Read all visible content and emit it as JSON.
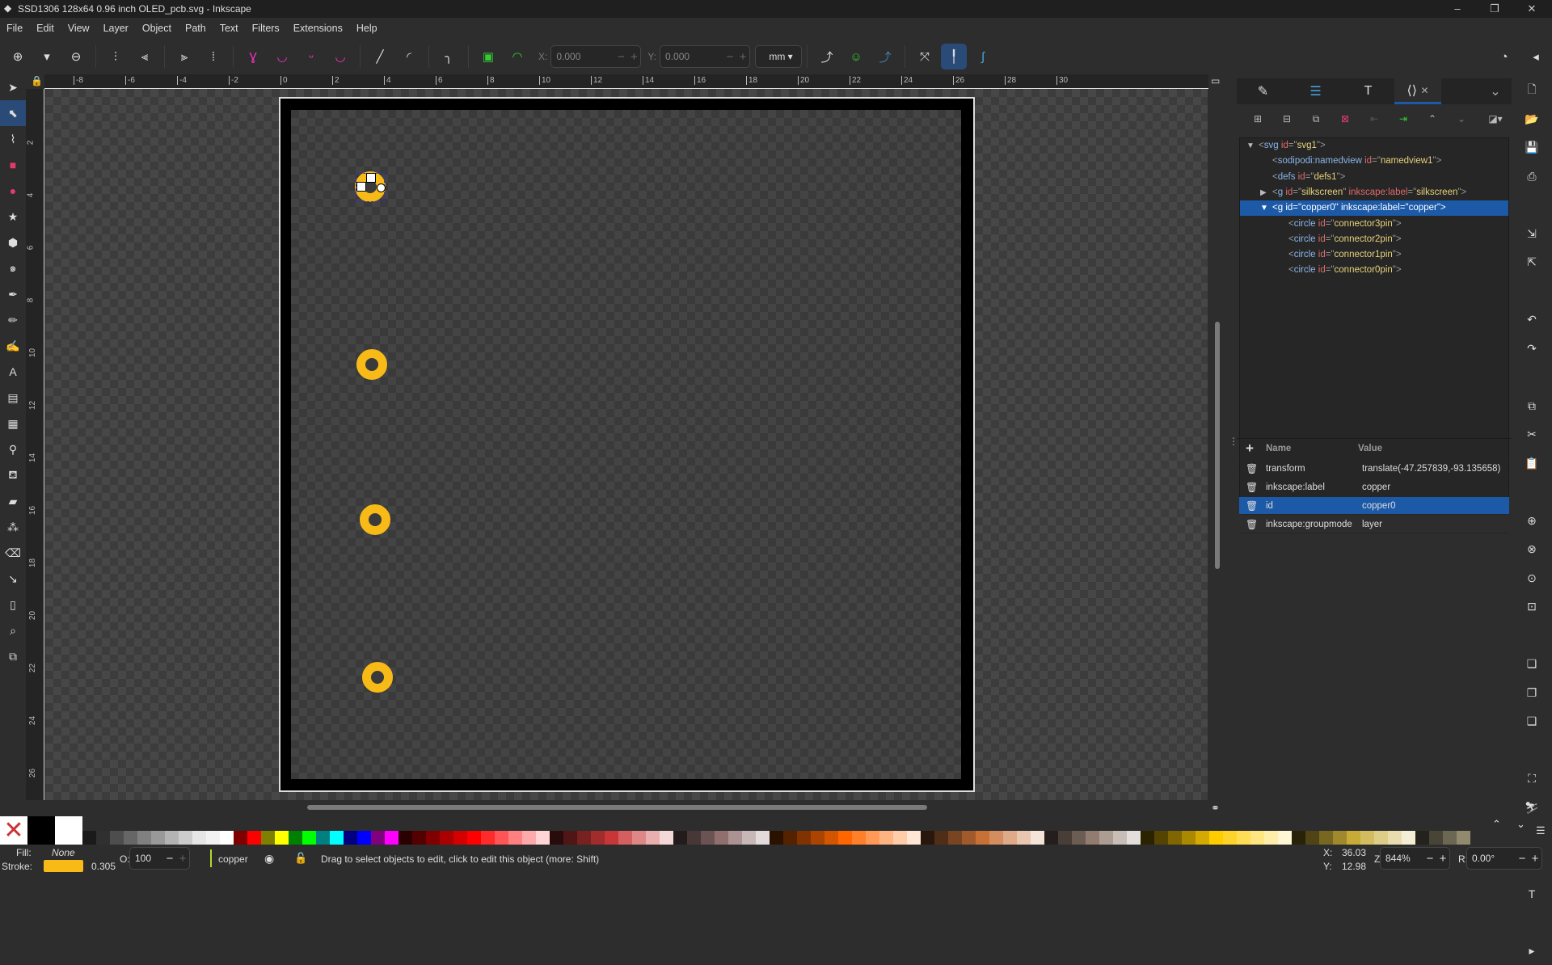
{
  "window": {
    "title": "SSD1306 128x64 0.96 inch OLED_pcb.svg - Inkscape",
    "minimize": "–",
    "maximize": "❐",
    "close": "✕"
  },
  "menu": [
    "File",
    "Edit",
    "View",
    "Layer",
    "Object",
    "Path",
    "Text",
    "Filters",
    "Extensions",
    "Help"
  ],
  "toolbar": {
    "x_label": "X:",
    "x_value": "0.000",
    "y_label": "Y:",
    "y_value": "0.000",
    "unit": "mm"
  },
  "tools": [
    "selector",
    "node",
    "tweak",
    "rectangle",
    "ellipse",
    "star",
    "3d-box",
    "spiral",
    "pen",
    "pencil",
    "calligraphy",
    "text",
    "gradient",
    "mesh",
    "dropper",
    "paint-bucket",
    "eraser-spray",
    "spray",
    "eraser",
    "connector",
    "pages",
    "zoom",
    "measure"
  ],
  "ruler_top": [
    "-8",
    "-6",
    "-4",
    "-2",
    "0",
    "2",
    "4",
    "6",
    "8",
    "10",
    "12",
    "14",
    "16",
    "18",
    "20",
    "22",
    "24",
    "26",
    "28",
    "30"
  ],
  "ruler_left": [
    "2",
    "4",
    "6",
    "8",
    "10",
    "12",
    "14",
    "16",
    "18",
    "20",
    "22",
    "24",
    "26"
  ],
  "accent": "#f8ba17",
  "dock": {
    "tabs": [
      "fill-stroke",
      "layers",
      "text-font",
      "xml-editor"
    ],
    "tree": [
      {
        "depth": 0,
        "expander": "open",
        "tag": "svg",
        "attrs": [
          [
            "id",
            "svg1"
          ]
        ]
      },
      {
        "depth": 1,
        "expander": "",
        "tag": "sodipodi:namedview",
        "attrs": [
          [
            "id",
            "namedview1"
          ]
        ]
      },
      {
        "depth": 1,
        "expander": "",
        "tag": "defs",
        "attrs": [
          [
            "id",
            "defs1"
          ]
        ]
      },
      {
        "depth": 1,
        "expander": "closed",
        "tag": "g",
        "attrs": [
          [
            "id",
            "silkscreen"
          ],
          [
            "inkscape:label",
            "silkscreen"
          ]
        ]
      },
      {
        "depth": 1,
        "expander": "open",
        "tag": "g",
        "attrs": [
          [
            "id",
            "copper0"
          ],
          [
            "inkscape:label",
            "copper"
          ]
        ],
        "selected": true
      },
      {
        "depth": 2,
        "expander": "",
        "tag": "circle",
        "attrs": [
          [
            "id",
            "connector3pin"
          ]
        ]
      },
      {
        "depth": 2,
        "expander": "",
        "tag": "circle",
        "attrs": [
          [
            "id",
            "connector2pin"
          ]
        ]
      },
      {
        "depth": 2,
        "expander": "",
        "tag": "circle",
        "attrs": [
          [
            "id",
            "connector1pin"
          ]
        ]
      },
      {
        "depth": 2,
        "expander": "",
        "tag": "circle",
        "attrs": [
          [
            "id",
            "connector0pin"
          ]
        ]
      }
    ],
    "attr_header": {
      "name": "Name",
      "value": "Value"
    },
    "attributes": [
      {
        "name": "transform",
        "value": "translate(-47.257839,-93.135658)"
      },
      {
        "name": "inkscape:label",
        "value": "copper"
      },
      {
        "name": "id",
        "value": "copper0",
        "selected": true
      },
      {
        "name": "inkscape:groupmode",
        "value": "layer"
      }
    ]
  },
  "palette": [
    "#1a1a1a",
    "#303030",
    "#4d4d4d",
    "#666666",
    "#808080",
    "#999999",
    "#b3b3b3",
    "#cccccc",
    "#e6e6e6",
    "#f2f2f2",
    "#ffffff",
    "#800000",
    "#ff0000",
    "#808000",
    "#ffff00",
    "#008000",
    "#00ff00",
    "#008080",
    "#00ffff",
    "#000080",
    "#0000ff",
    "#800080",
    "#ff00ff",
    "#2b0000",
    "#550000",
    "#800000",
    "#aa0000",
    "#d40000",
    "#ff0000",
    "#ff2a2a",
    "#ff5555",
    "#ff8080",
    "#ffaaaa",
    "#ffd5d5",
    "#280b0b",
    "#501616",
    "#782121",
    "#a02c2c",
    "#c83737",
    "#d35f5f",
    "#de8787",
    "#e9afaf",
    "#f4d7d7",
    "#241c1c",
    "#483737",
    "#6c5353",
    "#916f6f",
    "#ac9393",
    "#c8b7b7",
    "#e3dbdb",
    "#2b1100",
    "#552200",
    "#803300",
    "#aa4400",
    "#d45500",
    "#ff6600",
    "#ff7f2a",
    "#ff9955",
    "#ffb380",
    "#ffccaa",
    "#ffe6d5",
    "#28170b",
    "#502d16",
    "#784421",
    "#a05a2c",
    "#c87137",
    "#d38d5f",
    "#deaa87",
    "#e9c6af",
    "#f4e3d7",
    "#241f1c",
    "#483e37",
    "#6c5d53",
    "#917c6f",
    "#ac9d93",
    "#c8beb7",
    "#e3dedb",
    "#2b2200",
    "#554400",
    "#806600",
    "#aa8800",
    "#d4aa00",
    "#ffcc00",
    "#ffd42a",
    "#ffdd55",
    "#ffe680",
    "#ffeeaa",
    "#fff6d5",
    "#28220b",
    "#504416",
    "#786721",
    "#a0892c",
    "#c8ab37",
    "#d3bc5f",
    "#decd87",
    "#e9ddaf",
    "#f4eed7",
    "#24221c",
    "#484537",
    "#6c6753",
    "#918a6f"
  ],
  "status": {
    "fill_label": "Fill:",
    "fill_value": "None",
    "stroke_label": "Stroke:",
    "stroke_color": "#f8ba17",
    "stroke_width": "0.305",
    "opacity_label": "O:",
    "opacity_value": "100",
    "layer": "copper",
    "layer_color": "#b5d82b",
    "message": "Drag to select objects to edit, click to edit this object (more: Shift)",
    "x_label": "X:",
    "x_value": "36.03",
    "y_label": "Y:",
    "y_value": "12.98",
    "zoom_label": "Z:",
    "zoom_value": "844%",
    "rotate_label": "R:",
    "rotate_value": "0.00°"
  }
}
